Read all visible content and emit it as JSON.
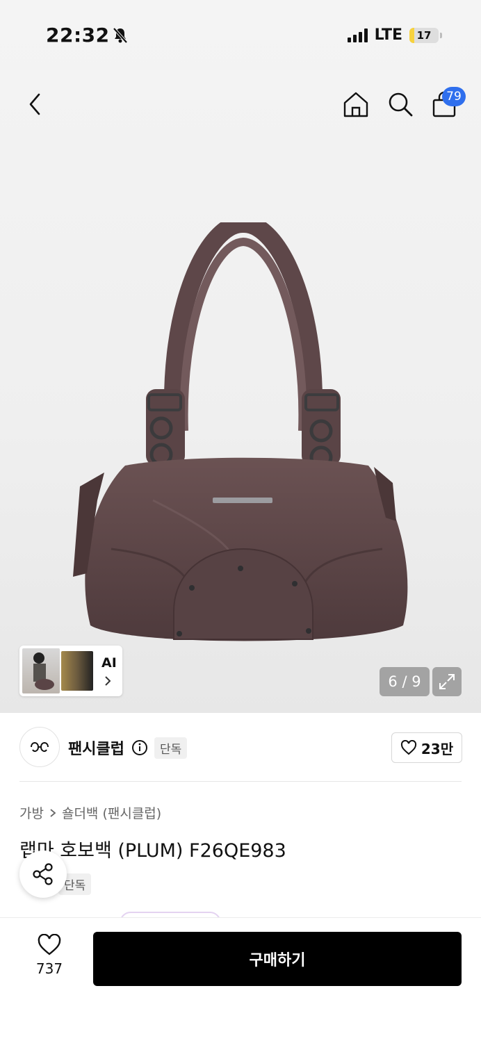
{
  "status": {
    "time": "22:32",
    "network": "LTE",
    "battery": "17",
    "battery_level": 0.17
  },
  "nav": {
    "cart_count": "79"
  },
  "gallery": {
    "ai_label": "AI",
    "page_indicator": "6 / 9"
  },
  "brand": {
    "name": "팬시클럽",
    "tag": "단독",
    "likes": "23만"
  },
  "breadcrumb": {
    "category": "가방",
    "subcategory": "숄더백 (팬시클럽)"
  },
  "product": {
    "title": "랩마 호보백 (PLUM) F26QE983",
    "tag": "단독"
  },
  "bottom": {
    "wish_count": "737",
    "buy_label": "구매하기"
  }
}
